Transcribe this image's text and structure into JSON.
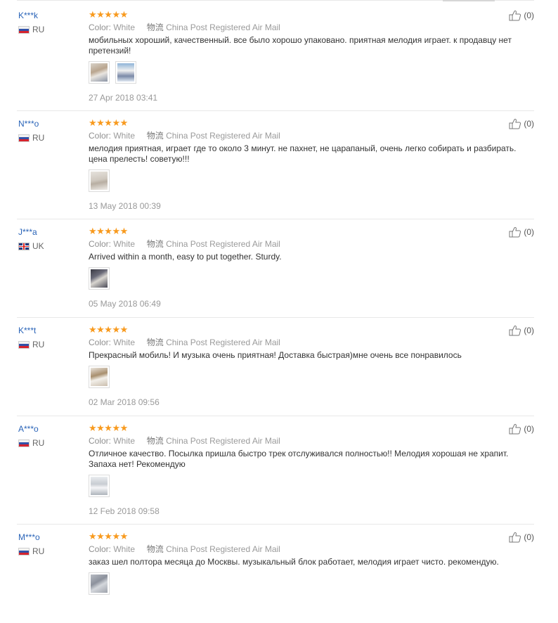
{
  "reviews": [
    {
      "user": "K***k",
      "country": "RU",
      "rating_stars": 5,
      "stars_text": "★★★★★",
      "color_label": "Color:",
      "color_value": "White",
      "shipping_label": "物流",
      "shipping_value": "China Post Registered Air Mail",
      "text": "мобильных хороший, качественный. все было хорошо упаковано. приятная мелодия играет. к продавцу нет претензий!",
      "photos": 2,
      "date": "27 Apr 2018 03:41",
      "helpful_count": "(0)"
    },
    {
      "user": "N***o",
      "country": "RU",
      "rating_stars": 5,
      "stars_text": "★★★★★",
      "color_label": "Color:",
      "color_value": "White",
      "shipping_label": "物流",
      "shipping_value": "China Post Registered Air Mail",
      "text": "мелодия приятная, играет где то около 3 минут. не пахнет, не царапаный, очень легко собирать и разбирать. цена прелесть! советую!!!",
      "photos": 1,
      "date": "13 May 2018 00:39",
      "helpful_count": "(0)"
    },
    {
      "user": "J***a",
      "country": "UK",
      "rating_stars": 5,
      "stars_text": "★★★★★",
      "color_label": "Color:",
      "color_value": "White",
      "shipping_label": "物流",
      "shipping_value": "China Post Registered Air Mail",
      "text": "Arrived within a month, easy to put together. Sturdy.",
      "photos": 1,
      "date": "05 May 2018 06:49",
      "helpful_count": "(0)"
    },
    {
      "user": "K***t",
      "country": "RU",
      "rating_stars": 5,
      "stars_text": "★★★★★",
      "color_label": "Color:",
      "color_value": "White",
      "shipping_label": "物流",
      "shipping_value": "China Post Registered Air Mail",
      "text": "Прекрасный мобиль! И музыка очень приятная! Доставка быстрая)мне очень все понравилось",
      "photos": 1,
      "date": "02 Mar 2018 09:56",
      "helpful_count": "(0)"
    },
    {
      "user": "A***o",
      "country": "RU",
      "rating_stars": 5,
      "stars_text": "★★★★★",
      "color_label": "Color:",
      "color_value": "White",
      "shipping_label": "物流",
      "shipping_value": "China Post Registered Air Mail",
      "text": "Отличное качество. Посылка пришла быстро трек отслуживался полностью!! Мелодия хорошая не храпит. Запаха нет! Рекомендую",
      "photos": 1,
      "date": "12 Feb 2018 09:58",
      "helpful_count": "(0)"
    },
    {
      "user": "M***o",
      "country": "RU",
      "rating_stars": 5,
      "stars_text": "★★★★★",
      "color_label": "Color:",
      "color_value": "White",
      "shipping_label": "物流",
      "shipping_value": "China Post Registered Air Mail",
      "text": "заказ шел полтора месяца до Москвы. музыкальный блок работает, мелодия играет чисто. рекомендую.",
      "photos": 1,
      "date": "",
      "helpful_count": "(0)"
    }
  ],
  "colors": {
    "user_link": "#2a64b8",
    "star": "#f89a1e",
    "meta_text": "#9a9a9a",
    "body_text": "#333333",
    "divider": "#e8e8e8"
  },
  "icons": {
    "thumbs_up": "thumbs-up-icon",
    "star": "star-icon",
    "flag_ru": "flag-ru-icon",
    "flag_uk": "flag-uk-icon"
  }
}
